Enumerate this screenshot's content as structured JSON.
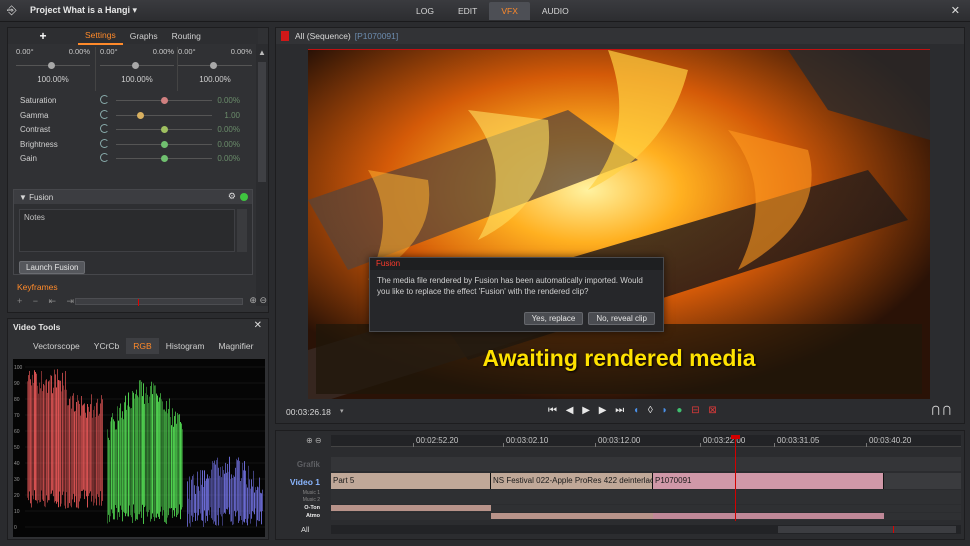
{
  "app": {
    "project_title": "Project What is a Hangi",
    "title_caret": "▾",
    "modes": [
      {
        "label": "LOG",
        "active": false
      },
      {
        "label": "EDIT",
        "active": false
      },
      {
        "label": "VFX",
        "active": true
      },
      {
        "label": "AUDIO",
        "active": false
      }
    ],
    "icons": {
      "exit": "exit-icon",
      "close": "close-icon"
    }
  },
  "settings": {
    "add_label": "+",
    "tabs": [
      "Settings",
      "Graphs",
      "Routing"
    ],
    "active_tab": "Settings",
    "wheels": [
      {
        "left": "0.00°",
        "right": "0.00%",
        "percent": "100.00%"
      },
      {
        "left": "0.00°",
        "right": "0.00%",
        "percent": "100.00%"
      },
      {
        "left": "0.00°",
        "right": "0.00%",
        "percent": "100.00%"
      }
    ],
    "adjustments": [
      {
        "label": "Saturation",
        "value": "0.00%",
        "knob_color": "#d08080",
        "knob_level": 0.5
      },
      {
        "label": "Gamma",
        "value": "1.00",
        "knob_color": "#d8b060",
        "knob_level": 0.25
      },
      {
        "label": "Contrast",
        "value": "0.00%",
        "knob_color": "#9fc060",
        "knob_level": 0.5
      },
      {
        "label": "Brightness",
        "value": "0.00%",
        "knob_color": "#70c070",
        "knob_level": 0.5
      },
      {
        "label": "Gain",
        "value": "0.00%",
        "knob_color": "#70c070",
        "knob_level": 0.5
      }
    ],
    "fusion": {
      "title": "Fusion",
      "notes_placeholder": "Notes",
      "launch_label": "Launch Fusion",
      "status_color": "#3fc43f"
    },
    "keyframes": {
      "label": "Keyframes",
      "controls": "+ − ⇤ ⇥",
      "zoom": "⊕ ⊖"
    }
  },
  "video_tools": {
    "title": "Video Tools",
    "tabs": [
      "Vectorscope",
      "YCrCb",
      "RGB",
      "Histogram",
      "Magnifier"
    ],
    "active_tab": "RGB",
    "scope_scale": [
      "100",
      "90",
      "80",
      "70",
      "60",
      "50",
      "40",
      "30",
      "20",
      "10",
      "0"
    ],
    "channel_colors": {
      "red": "#ff6060",
      "green": "#60ff60",
      "blue": "#8080ff"
    }
  },
  "viewer": {
    "sequence_label": "All (Sequence)",
    "clip_label": "[P1070091]",
    "overlay_text": "Awaiting rendered media",
    "dialog": {
      "title": "Fusion",
      "message": "The media file rendered by Fusion has been automatically imported. Would you like to replace the effect 'Fusion' with the rendered clip?",
      "yes_label": "Yes, replace",
      "no_label": "No, reveal clip"
    },
    "timecode": "00:03:26.18",
    "timecode_caret": "▾",
    "transport": {
      "skip_start": "⏮",
      "prev": "◀",
      "play": "▶",
      "next": "▶",
      "skip_end": "⏭",
      "mark_in": "◖",
      "mark_mid": "◊",
      "mark_out": "◗",
      "record": "●",
      "insert": "⊟",
      "overwrite": "⊠"
    },
    "loop_icons": "⋂⋂"
  },
  "timeline": {
    "zoom": "⊕ ⊖",
    "ruler_labels": [
      "00:02:52.20",
      "00:03:02.10",
      "00:03:12.00",
      "00:03:22.00",
      "00:03:31.05",
      "00:03:40.20"
    ],
    "tracks": [
      {
        "label": "Grafik",
        "style": "dim"
      },
      {
        "label": "Video 1",
        "style": "main"
      },
      {
        "label": "Music 1",
        "style": "tiny"
      },
      {
        "label": "Music 2",
        "style": "tiny"
      },
      {
        "label": "O-Ton",
        "style": "tag"
      },
      {
        "label": "Atmo",
        "style": "tag"
      }
    ],
    "clips": [
      {
        "name": "Part 5",
        "color": "#c0a898"
      },
      {
        "name": "NS Festival 022-Apple ProRes 422 deinterlaced",
        "color": "#c0a898"
      },
      {
        "name": "P1070091",
        "color": "#d098a8"
      }
    ],
    "all_label": "All"
  }
}
